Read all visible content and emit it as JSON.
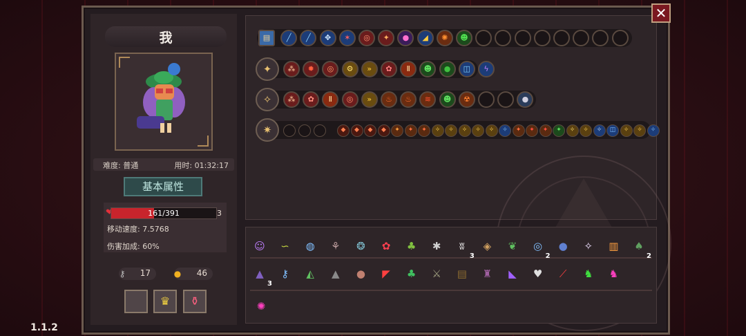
{
  "player": {
    "name": "我"
  },
  "info": {
    "difficulty": "难度: 普通",
    "time": "用时: 01:32:17"
  },
  "stats": {
    "tab_label": "基本属性",
    "hp_text": "161/391",
    "hp_fraction": 0.41,
    "hp_extra": "3",
    "move_speed": "移动速度: 7.5768",
    "damage_bonus": "伤害加成: 60%"
  },
  "resources": {
    "keys": "17",
    "coins": "46"
  },
  "close_label": "✕",
  "version": "1.1.2",
  "colors": {
    "hp": "#c8242c",
    "panel": "#241c20",
    "accent": "#4e7a78"
  },
  "inventory": {
    "row1": [
      {
        "icon": "treasure-chest-icon",
        "g": "▤",
        "bg": "#3a6aa8",
        "fg": "#f0d090",
        "shape": "sq"
      },
      {
        "icon": "blue-bolt-icon",
        "g": "╱",
        "bg": "#1c3c78",
        "fg": "#8ad0ff"
      },
      {
        "icon": "blue-bolt-icon",
        "g": "╱",
        "bg": "#1c3c78",
        "fg": "#8ad0ff"
      },
      {
        "icon": "triple-orb-icon",
        "g": "✥",
        "bg": "#1c3c78",
        "fg": "#d0e8ff"
      },
      {
        "icon": "fire-burst-icon",
        "g": "✶",
        "bg": "#1c3c78",
        "fg": "#ff6060"
      },
      {
        "icon": "target-icon",
        "g": "◎",
        "bg": "#6a1c1c",
        "fg": "#ff9070"
      },
      {
        "icon": "ember-icon",
        "g": "✦",
        "bg": "#6a1c1c",
        "fg": "#ffb060"
      },
      {
        "icon": "pink-orb-icon",
        "g": "●",
        "bg": "#3a1c5a",
        "fg": "#ff70d0"
      },
      {
        "icon": "fan-icon",
        "g": "◢",
        "bg": "#1c3c78",
        "fg": "#ffcc40"
      },
      {
        "icon": "flame-ring-icon",
        "g": "✺",
        "bg": "#6a2c10",
        "fg": "#ff9030"
      },
      {
        "icon": "green-skull-icon",
        "g": "☻",
        "bg": "#1c4a1c",
        "fg": "#50e050"
      },
      {
        "icon": "empty",
        "g": "",
        "bg": "#1a1416",
        "fg": "#fff"
      },
      {
        "icon": "empty",
        "g": "",
        "bg": "#1a1416",
        "fg": "#fff"
      },
      {
        "icon": "empty",
        "g": "",
        "bg": "#1a1416",
        "fg": "#fff"
      },
      {
        "icon": "empty",
        "g": "",
        "bg": "#1a1416",
        "fg": "#fff"
      },
      {
        "icon": "empty",
        "g": "",
        "bg": "#1a1416",
        "fg": "#fff"
      },
      {
        "icon": "empty",
        "g": "",
        "bg": "#1a1416",
        "fg": "#fff"
      },
      {
        "icon": "empty",
        "g": "",
        "bg": "#1a1416",
        "fg": "#fff"
      },
      {
        "icon": "empty",
        "g": "",
        "bg": "#1a1416",
        "fg": "#fff"
      }
    ],
    "wand2": {
      "icon": "crystal-wand-icon",
      "g": "✦"
    },
    "row2": [
      {
        "icon": "split-spell-icon",
        "g": "⁂",
        "bg": "#6a1c1c",
        "fg": "#ffd0a0"
      },
      {
        "icon": "swirl-icon",
        "g": "✹",
        "bg": "#6a1c1c",
        "fg": "#ff6040"
      },
      {
        "icon": "target-icon",
        "g": "◎",
        "bg": "#6a1c1c",
        "fg": "#ffa070"
      },
      {
        "icon": "gear-icon",
        "g": "⚙",
        "bg": "#6a4c10",
        "fg": "#ffe070"
      },
      {
        "icon": "double-arrow-icon",
        "g": "»",
        "bg": "#6a4c10",
        "fg": "#ffd040"
      },
      {
        "icon": "flower-icon",
        "g": "✿",
        "bg": "#6a1c1c",
        "fg": "#ff8080"
      },
      {
        "icon": "pause-icon",
        "g": "Ⅱ",
        "bg": "#8a2a10",
        "fg": "#ffe0a0"
      },
      {
        "icon": "green-skull-icon",
        "g": "☻",
        "bg": "#1c4a1c",
        "fg": "#60e060"
      },
      {
        "icon": "green-orb-icon",
        "g": "●",
        "bg": "#1c4a1c",
        "fg": "#40c040"
      },
      {
        "icon": "spiral-icon",
        "g": "◫",
        "bg": "#1c3c78",
        "fg": "#80d0ff"
      },
      {
        "icon": "lightning-icon",
        "g": "ϟ",
        "bg": "#1c3c78",
        "fg": "#c080ff"
      }
    ],
    "wand3": {
      "icon": "staff-wand-icon",
      "g": "✧"
    },
    "row3": [
      {
        "icon": "split-spell-icon",
        "g": "⁂",
        "bg": "#6a1c1c",
        "fg": "#ffd0a0"
      },
      {
        "icon": "flower-icon",
        "g": "✿",
        "bg": "#6a1c1c",
        "fg": "#ff9080"
      },
      {
        "icon": "pause-icon",
        "g": "Ⅱ",
        "bg": "#8a2a10",
        "fg": "#ffe0a0"
      },
      {
        "icon": "target-icon",
        "g": "◎",
        "bg": "#6a1c1c",
        "fg": "#ff9070"
      },
      {
        "icon": "double-arrow-icon",
        "g": "»",
        "bg": "#6a4c10",
        "fg": "#ffd040"
      },
      {
        "icon": "fire-claw-icon",
        "g": "♨",
        "bg": "#6a2c10",
        "fg": "#ff7030"
      },
      {
        "icon": "fire-claw-icon",
        "g": "♨",
        "bg": "#6a2c10",
        "fg": "#ff7030"
      },
      {
        "icon": "fire-slash-icon",
        "g": "≋",
        "bg": "#6a2c10",
        "fg": "#ff5030"
      },
      {
        "icon": "green-skull-icon",
        "g": "☻",
        "bg": "#1c4a1c",
        "fg": "#60e060"
      },
      {
        "icon": "radiation-icon",
        "g": "☢",
        "bg": "#6a2c10",
        "fg": "#ff8030"
      },
      {
        "icon": "empty",
        "g": "",
        "bg": "#1a1416",
        "fg": "#fff"
      },
      {
        "icon": "empty",
        "g": "",
        "bg": "#1a1416",
        "fg": "#fff"
      },
      {
        "icon": "bomb-icon",
        "g": "●",
        "bg": "#2a3c5a",
        "fg": "#d0d0e0"
      }
    ],
    "wand4": {
      "icon": "gold-staff-icon",
      "g": "✷"
    },
    "row4_empty": 3,
    "row4": [
      {
        "icon": "rune-icon",
        "g": "◆",
        "bg": "#4a1810",
        "fg": "#ff8050"
      },
      {
        "icon": "rune-icon",
        "g": "◆",
        "bg": "#4a1810",
        "fg": "#ff8050"
      },
      {
        "icon": "rune-icon",
        "g": "◆",
        "bg": "#4a1810",
        "fg": "#ff8050"
      },
      {
        "icon": "rune-icon",
        "g": "◆",
        "bg": "#4a1810",
        "fg": "#ff8050"
      },
      {
        "icon": "fire-rune-icon",
        "g": "✦",
        "bg": "#5a2a10",
        "fg": "#ffa040"
      },
      {
        "icon": "fire-rune-icon",
        "g": "✦",
        "bg": "#5a2a10",
        "fg": "#ff7040"
      },
      {
        "icon": "fire-rune-icon",
        "g": "✦",
        "bg": "#5a2a10",
        "fg": "#ff7040"
      },
      {
        "icon": "gold-rune-icon",
        "g": "✧",
        "bg": "#5a4010",
        "fg": "#ffd050"
      },
      {
        "icon": "gold-rune-icon",
        "g": "✧",
        "bg": "#5a4010",
        "fg": "#ffd050"
      },
      {
        "icon": "gold-rune-icon",
        "g": "✧",
        "bg": "#5a4010",
        "fg": "#ffd050"
      },
      {
        "icon": "gold-rune-icon",
        "g": "✧",
        "bg": "#5a4010",
        "fg": "#ffd050"
      },
      {
        "icon": "gold-rune-icon",
        "g": "✧",
        "bg": "#5a4010",
        "fg": "#ffd050"
      },
      {
        "icon": "blue-rune-icon",
        "g": "✧",
        "bg": "#1c3c78",
        "fg": "#80c0ff"
      },
      {
        "icon": "fire-rune-icon",
        "g": "✦",
        "bg": "#5a2a10",
        "fg": "#ff7040"
      },
      {
        "icon": "fire-rune-icon",
        "g": "✦",
        "bg": "#5a2a10",
        "fg": "#ff5040"
      },
      {
        "icon": "fire-rune-icon",
        "g": "✦",
        "bg": "#5a2a10",
        "fg": "#ff5040"
      },
      {
        "icon": "green-rune-icon",
        "g": "✦",
        "bg": "#1c4a1c",
        "fg": "#60e060"
      },
      {
        "icon": "gold-rune-icon",
        "g": "✧",
        "bg": "#5a4010",
        "fg": "#ffe070"
      },
      {
        "icon": "gold-rune-icon",
        "g": "✧",
        "bg": "#5a4010",
        "fg": "#ffd050"
      },
      {
        "icon": "blue-rune-icon",
        "g": "✧",
        "bg": "#1c3c78",
        "fg": "#c0e0ff"
      },
      {
        "icon": "blue-rune-icon",
        "g": "◫",
        "bg": "#1c3c78",
        "fg": "#80c0ff"
      },
      {
        "icon": "gold-rune-icon",
        "g": "✧",
        "bg": "#5a4010",
        "fg": "#ffd050"
      },
      {
        "icon": "gold-rune-icon",
        "g": "✧",
        "bg": "#5a4010",
        "fg": "#ffd050"
      },
      {
        "icon": "blue-rune-icon",
        "g": "✧",
        "bg": "#1c3c78",
        "fg": "#80c0ff"
      }
    ]
  },
  "relics_row1": [
    {
      "icon": "hooded-mage-icon",
      "g": "☺",
      "fg": "#c080ff",
      "count": ""
    },
    {
      "icon": "worm-icon",
      "g": "∽",
      "fg": "#c0d040",
      "count": ""
    },
    {
      "icon": "mirror-icon",
      "g": "◍",
      "fg": "#80c0ff",
      "count": ""
    },
    {
      "icon": "quill-icon",
      "g": "⚘",
      "fg": "#c0a0a0",
      "count": ""
    },
    {
      "icon": "amulet-icon",
      "g": "❂",
      "fg": "#80c0d0",
      "count": ""
    },
    {
      "icon": "red-flower-icon",
      "g": "✿",
      "fg": "#ff4050",
      "count": ""
    },
    {
      "icon": "green-flask-icon",
      "g": "♣",
      "fg": "#80c040",
      "count": ""
    },
    {
      "icon": "spider-icon",
      "g": "✱",
      "fg": "#d0d0d0",
      "count": ""
    },
    {
      "icon": "fang-icon",
      "g": "ʬ",
      "fg": "#f0f0f0",
      "count": "3"
    },
    {
      "icon": "shell-icon",
      "g": "◈",
      "fg": "#d0a060",
      "count": ""
    },
    {
      "icon": "leaf-icon",
      "g": "❦",
      "fg": "#60c060",
      "count": ""
    },
    {
      "icon": "ring-icon",
      "g": "◎",
      "fg": "#80c0ff",
      "count": "2"
    },
    {
      "icon": "blue-beetle-icon",
      "g": "●",
      "fg": "#6080d0",
      "count": ""
    },
    {
      "icon": "fairy-icon",
      "g": "✧",
      "fg": "#f0e0ff",
      "count": ""
    },
    {
      "icon": "scroll-icon",
      "g": "▥",
      "fg": "#ffa040",
      "count": ""
    },
    {
      "icon": "moss-icon",
      "g": "♠",
      "fg": "#60a060",
      "count": "2"
    }
  ],
  "relics_row2": [
    {
      "icon": "dark-cloak-icon",
      "g": "▲",
      "fg": "#8060c0",
      "count": "3"
    },
    {
      "icon": "key-icon",
      "g": "⚷",
      "fg": "#80c0ff",
      "count": ""
    },
    {
      "icon": "green-hat-icon",
      "g": "◭",
      "fg": "#60c060",
      "count": ""
    },
    {
      "icon": "gray-robe-icon",
      "g": "▲",
      "fg": "#8a8a8a",
      "count": ""
    },
    {
      "icon": "egg-icon",
      "g": "●",
      "fg": "#c08070",
      "count": ""
    },
    {
      "icon": "red-bird-icon",
      "g": "◤",
      "fg": "#ff4040",
      "count": ""
    },
    {
      "icon": "clover-icon",
      "g": "♣",
      "fg": "#40c060",
      "count": ""
    },
    {
      "icon": "stone-sword-icon",
      "g": "⚔",
      "fg": "#a0a080",
      "count": ""
    },
    {
      "icon": "dark-chest-icon",
      "g": "▤",
      "fg": "#8a6a30",
      "count": ""
    },
    {
      "icon": "purple-idol-icon",
      "g": "♜",
      "fg": "#a060a0",
      "count": ""
    },
    {
      "icon": "purple-boot-icon",
      "g": "◣",
      "fg": "#a060ff",
      "count": ""
    },
    {
      "icon": "skull-heart-icon",
      "g": "♥",
      "fg": "#e0e0e0",
      "count": ""
    },
    {
      "icon": "red-feather-icon",
      "g": "⟋",
      "fg": "#ff4040",
      "count": ""
    },
    {
      "icon": "green-demon-icon",
      "g": "♞",
      "fg": "#40e040",
      "count": ""
    },
    {
      "icon": "pink-demon-icon",
      "g": "♞",
      "fg": "#ff40c0",
      "count": ""
    }
  ],
  "relics_row3": [
    {
      "icon": "magenta-vortex-icon",
      "g": "✺",
      "fg": "#ff40c0",
      "count": ""
    }
  ]
}
